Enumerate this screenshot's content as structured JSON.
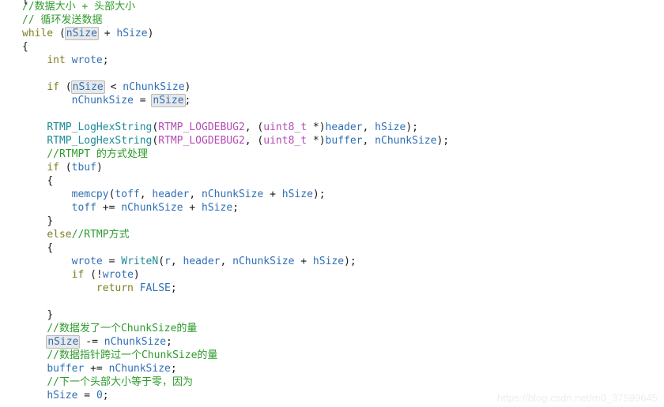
{
  "editor": {
    "background_color": "#ffffff",
    "default_text_color": "#1a1a1a",
    "language": "C",
    "clipped_top_fragment": "{",
    "highlight_token": "nSize",
    "highlight_box_color": "#e8e8e8",
    "highlight_border_color": "#b9b9b9"
  },
  "colors": {
    "comment": "#2e9b2e",
    "keyword": "#7f7f22",
    "identifier": "#2f6fb5",
    "function": "#1d8a95",
    "macro": "#b34bb3",
    "type": "#b34bb3",
    "punctuation": "#1a1a1a",
    "watermark": "#eeeeee"
  },
  "watermark": {
    "text": "https://blog.csdn.net/m0_37599645"
  },
  "code": {
    "lines": [
      {
        "n": 1,
        "text": "//数据大小 + 头部大小",
        "tokens": [
          {
            "t": "//数据大小 + 头部大小",
            "c": "t-comment"
          }
        ]
      },
      {
        "n": 2,
        "text": "// 循环发送数据",
        "tokens": [
          {
            "t": "// 循环发送数据",
            "c": "t-comment"
          }
        ]
      },
      {
        "n": 3,
        "text": "while (nSize + hSize)",
        "tokens": [
          {
            "t": "while",
            "c": "t-keyword"
          },
          {
            "t": " (",
            "c": "t-punct"
          },
          {
            "t": "nSize",
            "c": "hl"
          },
          {
            "t": " + ",
            "c": "t-punct"
          },
          {
            "t": "hSize",
            "c": "t-ident"
          },
          {
            "t": ")",
            "c": "t-punct"
          }
        ]
      },
      {
        "n": 4,
        "text": "{",
        "tokens": [
          {
            "t": "{",
            "c": "t-punct"
          }
        ]
      },
      {
        "n": 5,
        "text": "    int wrote;",
        "tokens": [
          {
            "t": "    ",
            "c": "t-plain"
          },
          {
            "t": "int",
            "c": "t-keyword"
          },
          {
            "t": " ",
            "c": "t-plain"
          },
          {
            "t": "wrote",
            "c": "t-ident"
          },
          {
            "t": ";",
            "c": "t-punct"
          }
        ]
      },
      {
        "n": 6,
        "text": "",
        "tokens": []
      },
      {
        "n": 7,
        "text": "    if (nSize < nChunkSize)",
        "tokens": [
          {
            "t": "    ",
            "c": "t-plain"
          },
          {
            "t": "if",
            "c": "t-keyword"
          },
          {
            "t": " (",
            "c": "t-punct"
          },
          {
            "t": "nSize",
            "c": "hl"
          },
          {
            "t": " < ",
            "c": "t-punct"
          },
          {
            "t": "nChunkSize",
            "c": "t-ident"
          },
          {
            "t": ")",
            "c": "t-punct"
          }
        ]
      },
      {
        "n": 8,
        "text": "        nChunkSize = nSize;",
        "tokens": [
          {
            "t": "        ",
            "c": "t-plain"
          },
          {
            "t": "nChunkSize",
            "c": "t-ident"
          },
          {
            "t": " = ",
            "c": "t-punct"
          },
          {
            "t": "nSize",
            "c": "hl"
          },
          {
            "t": ";",
            "c": "t-punct"
          }
        ]
      },
      {
        "n": 9,
        "text": "",
        "tokens": []
      },
      {
        "n": 10,
        "text": "    RTMP_LogHexString(RTMP_LOGDEBUG2, (uint8_t *)header, hSize);",
        "tokens": [
          {
            "t": "    ",
            "c": "t-plain"
          },
          {
            "t": "RTMP_LogHexString",
            "c": "t-func"
          },
          {
            "t": "(",
            "c": "t-punct"
          },
          {
            "t": "RTMP_LOGDEBUG2",
            "c": "t-macro"
          },
          {
            "t": ", (",
            "c": "t-punct"
          },
          {
            "t": "uint8_t",
            "c": "t-type"
          },
          {
            "t": " *)",
            "c": "t-punct"
          },
          {
            "t": "header",
            "c": "t-ident"
          },
          {
            "t": ", ",
            "c": "t-punct"
          },
          {
            "t": "hSize",
            "c": "t-ident"
          },
          {
            "t": ");",
            "c": "t-punct"
          }
        ]
      },
      {
        "n": 11,
        "text": "    RTMP_LogHexString(RTMP_LOGDEBUG2, (uint8_t *)buffer, nChunkSize);",
        "tokens": [
          {
            "t": "    ",
            "c": "t-plain"
          },
          {
            "t": "RTMP_LogHexString",
            "c": "t-func"
          },
          {
            "t": "(",
            "c": "t-punct"
          },
          {
            "t": "RTMP_LOGDEBUG2",
            "c": "t-macro"
          },
          {
            "t": ", (",
            "c": "t-punct"
          },
          {
            "t": "uint8_t",
            "c": "t-type"
          },
          {
            "t": " *)",
            "c": "t-punct"
          },
          {
            "t": "buffer",
            "c": "t-ident"
          },
          {
            "t": ", ",
            "c": "t-punct"
          },
          {
            "t": "nChunkSize",
            "c": "t-ident"
          },
          {
            "t": ");",
            "c": "t-punct"
          }
        ]
      },
      {
        "n": 12,
        "text": "    //RTMPT 的方式处理",
        "tokens": [
          {
            "t": "    ",
            "c": "t-plain"
          },
          {
            "t": "//RTMPT 的方式处理",
            "c": "t-comment"
          }
        ]
      },
      {
        "n": 13,
        "text": "    if (tbuf)",
        "tokens": [
          {
            "t": "    ",
            "c": "t-plain"
          },
          {
            "t": "if",
            "c": "t-keyword"
          },
          {
            "t": " (",
            "c": "t-punct"
          },
          {
            "t": "tbuf",
            "c": "t-ident"
          },
          {
            "t": ")",
            "c": "t-punct"
          }
        ]
      },
      {
        "n": 14,
        "text": "    {",
        "tokens": [
          {
            "t": "    ",
            "c": "t-plain"
          },
          {
            "t": "{",
            "c": "t-punct"
          }
        ]
      },
      {
        "n": 15,
        "text": "        memcpy(toff, header, nChunkSize + hSize);",
        "tokens": [
          {
            "t": "        ",
            "c": "t-plain"
          },
          {
            "t": "memcpy",
            "c": "t-ident"
          },
          {
            "t": "(",
            "c": "t-punct"
          },
          {
            "t": "toff",
            "c": "t-ident"
          },
          {
            "t": ", ",
            "c": "t-punct"
          },
          {
            "t": "header",
            "c": "t-ident"
          },
          {
            "t": ", ",
            "c": "t-punct"
          },
          {
            "t": "nChunkSize",
            "c": "t-ident"
          },
          {
            "t": " + ",
            "c": "t-punct"
          },
          {
            "t": "hSize",
            "c": "t-ident"
          },
          {
            "t": ");",
            "c": "t-punct"
          }
        ]
      },
      {
        "n": 16,
        "text": "        toff += nChunkSize + hSize;",
        "tokens": [
          {
            "t": "        ",
            "c": "t-plain"
          },
          {
            "t": "toff",
            "c": "t-ident"
          },
          {
            "t": " += ",
            "c": "t-punct"
          },
          {
            "t": "nChunkSize",
            "c": "t-ident"
          },
          {
            "t": " + ",
            "c": "t-punct"
          },
          {
            "t": "hSize",
            "c": "t-ident"
          },
          {
            "t": ";",
            "c": "t-punct"
          }
        ]
      },
      {
        "n": 17,
        "text": "    }",
        "tokens": [
          {
            "t": "    ",
            "c": "t-plain"
          },
          {
            "t": "}",
            "c": "t-punct"
          }
        ]
      },
      {
        "n": 18,
        "text": "    else//RTMP方式",
        "tokens": [
          {
            "t": "    ",
            "c": "t-plain"
          },
          {
            "t": "else",
            "c": "t-keyword"
          },
          {
            "t": "//RTMP方式",
            "c": "t-comment"
          }
        ]
      },
      {
        "n": 19,
        "text": "    {",
        "tokens": [
          {
            "t": "    ",
            "c": "t-plain"
          },
          {
            "t": "{",
            "c": "t-punct"
          }
        ]
      },
      {
        "n": 20,
        "text": "        wrote = WriteN(r, header, nChunkSize + hSize);",
        "tokens": [
          {
            "t": "        ",
            "c": "t-plain"
          },
          {
            "t": "wrote",
            "c": "t-ident"
          },
          {
            "t": " = ",
            "c": "t-punct"
          },
          {
            "t": "WriteN",
            "c": "t-func"
          },
          {
            "t": "(",
            "c": "t-punct"
          },
          {
            "t": "r",
            "c": "t-ident"
          },
          {
            "t": ", ",
            "c": "t-punct"
          },
          {
            "t": "header",
            "c": "t-ident"
          },
          {
            "t": ", ",
            "c": "t-punct"
          },
          {
            "t": "nChunkSize",
            "c": "t-ident"
          },
          {
            "t": " + ",
            "c": "t-punct"
          },
          {
            "t": "hSize",
            "c": "t-ident"
          },
          {
            "t": ");",
            "c": "t-punct"
          }
        ]
      },
      {
        "n": 21,
        "text": "        if (!wrote)",
        "tokens": [
          {
            "t": "        ",
            "c": "t-plain"
          },
          {
            "t": "if",
            "c": "t-keyword"
          },
          {
            "t": " (!",
            "c": "t-punct"
          },
          {
            "t": "wrote",
            "c": "t-ident"
          },
          {
            "t": ")",
            "c": "t-punct"
          }
        ]
      },
      {
        "n": 22,
        "text": "            return FALSE;",
        "tokens": [
          {
            "t": "            ",
            "c": "t-plain"
          },
          {
            "t": "return",
            "c": "t-keyword"
          },
          {
            "t": " ",
            "c": "t-plain"
          },
          {
            "t": "FALSE",
            "c": "t-const"
          },
          {
            "t": ";",
            "c": "t-punct"
          }
        ]
      },
      {
        "n": 23,
        "text": "",
        "tokens": []
      },
      {
        "n": 24,
        "text": "    }",
        "tokens": [
          {
            "t": "    ",
            "c": "t-plain"
          },
          {
            "t": "}",
            "c": "t-punct"
          }
        ]
      },
      {
        "n": 25,
        "text": "    //数据发了一个ChunkSize的量",
        "tokens": [
          {
            "t": "    ",
            "c": "t-plain"
          },
          {
            "t": "//数据发了一个ChunkSize的量",
            "c": "t-comment"
          }
        ]
      },
      {
        "n": 26,
        "text": "    nSize -= nChunkSize;",
        "tokens": [
          {
            "t": "    ",
            "c": "t-plain"
          },
          {
            "t": "nSize",
            "c": "hl"
          },
          {
            "t": " -= ",
            "c": "t-punct"
          },
          {
            "t": "nChunkSize",
            "c": "t-ident"
          },
          {
            "t": ";",
            "c": "t-punct"
          }
        ]
      },
      {
        "n": 27,
        "text": "    //数据指针跨过一个ChunkSize的量",
        "tokens": [
          {
            "t": "    ",
            "c": "t-plain"
          },
          {
            "t": "//数据指针跨过一个ChunkSize的量",
            "c": "t-comment"
          }
        ]
      },
      {
        "n": 28,
        "text": "    buffer += nChunkSize;",
        "tokens": [
          {
            "t": "    ",
            "c": "t-plain"
          },
          {
            "t": "buffer",
            "c": "t-ident"
          },
          {
            "t": " += ",
            "c": "t-punct"
          },
          {
            "t": "nChunkSize",
            "c": "t-ident"
          },
          {
            "t": ";",
            "c": "t-punct"
          }
        ]
      },
      {
        "n": 29,
        "text": "    //下一个头部大小等于零，因为",
        "tokens": [
          {
            "t": "    ",
            "c": "t-plain"
          },
          {
            "t": "//下一个头部大小等于零，因为",
            "c": "t-comment"
          }
        ]
      },
      {
        "n": 30,
        "text": "    hSize = 0;",
        "tokens": [
          {
            "t": "    ",
            "c": "t-plain"
          },
          {
            "t": "hSize",
            "c": "t-ident"
          },
          {
            "t": " = ",
            "c": "t-punct"
          },
          {
            "t": "0",
            "c": "t-num"
          },
          {
            "t": ";",
            "c": "t-punct"
          }
        ]
      }
    ]
  }
}
